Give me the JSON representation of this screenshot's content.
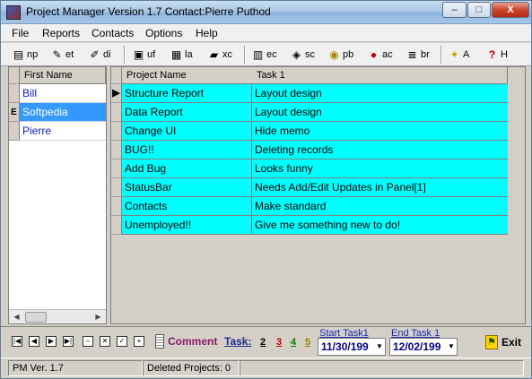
{
  "window": {
    "title": "Project Manager Version 1.7    Contact:Pierre Puthod",
    "controls": {
      "minimize": "–",
      "maximize": "□",
      "close": "X"
    }
  },
  "menu": [
    "File",
    "Reports",
    "Contacts",
    "Options",
    "Help"
  ],
  "toolbar": [
    {
      "label": "np",
      "icon": "new-project-icon",
      "glyph": "▤"
    },
    {
      "label": "et",
      "icon": "edit-task-icon",
      "glyph": "✎"
    },
    {
      "label": "di",
      "icon": "diary-icon",
      "glyph": "✐"
    },
    {
      "label": "uf",
      "icon": "update-file-icon",
      "glyph": "▣"
    },
    {
      "label": "la",
      "icon": "layout-icon",
      "glyph": "▦"
    },
    {
      "label": "xc",
      "icon": "folder-icon",
      "glyph": "▰"
    },
    {
      "label": "ec",
      "icon": "export-icon",
      "glyph": "▥"
    },
    {
      "label": "sc",
      "icon": "schedule-icon",
      "glyph": "◈"
    },
    {
      "label": "pb",
      "icon": "probe-icon",
      "glyph": "◉"
    },
    {
      "label": "ac",
      "icon": "accent-icon",
      "glyph": "●"
    },
    {
      "label": "br",
      "icon": "browse-icon",
      "glyph": "≣"
    },
    {
      "label": "A",
      "icon": "bulb-icon",
      "glyph": "✦"
    },
    {
      "label": "H",
      "icon": "help-icon",
      "glyph": "?"
    }
  ],
  "contacts_grid": {
    "header": "First Name",
    "rows": [
      "Bill",
      "Softpedia",
      "Pierre"
    ],
    "selected_index": 1,
    "indicator": "E"
  },
  "projects_grid": {
    "headers": [
      "Project Name",
      "Task 1"
    ],
    "rows": [
      [
        "Structure Report",
        "Layout design"
      ],
      [
        "Data Report",
        "Layout design"
      ],
      [
        "Change UI",
        "Hide memo"
      ],
      [
        "BUG!!",
        "Deleting records"
      ],
      [
        "Add Bug",
        "Looks funny"
      ],
      [
        "StatusBar",
        "Needs Add/Edit Updates in Panel[1]"
      ],
      [
        "Contacts",
        "Make standard"
      ],
      [
        "Unemployed!!",
        "Give me something new to do!"
      ]
    ],
    "current_row_marker": "▶"
  },
  "navigator": [
    "|◀",
    "◀",
    "▶",
    "▶|",
    "–",
    "✕",
    "✓",
    "+"
  ],
  "bottom": {
    "comment_label": "Comment",
    "task_label": "Task:",
    "task_numbers": [
      {
        "n": "2",
        "color": "#000000"
      },
      {
        "n": "3",
        "color": "#c00000"
      },
      {
        "n": "4",
        "color": "#008000"
      },
      {
        "n": "5",
        "color": "#a08000"
      }
    ],
    "start_label": "Start Task1",
    "start_value": "11/30/199",
    "end_label": "End Task 1",
    "end_value": "12/02/199",
    "exit_label": "Exit"
  },
  "status": {
    "version": "PM Ver. 1.7",
    "deleted": "Deleted Projects:  0"
  }
}
